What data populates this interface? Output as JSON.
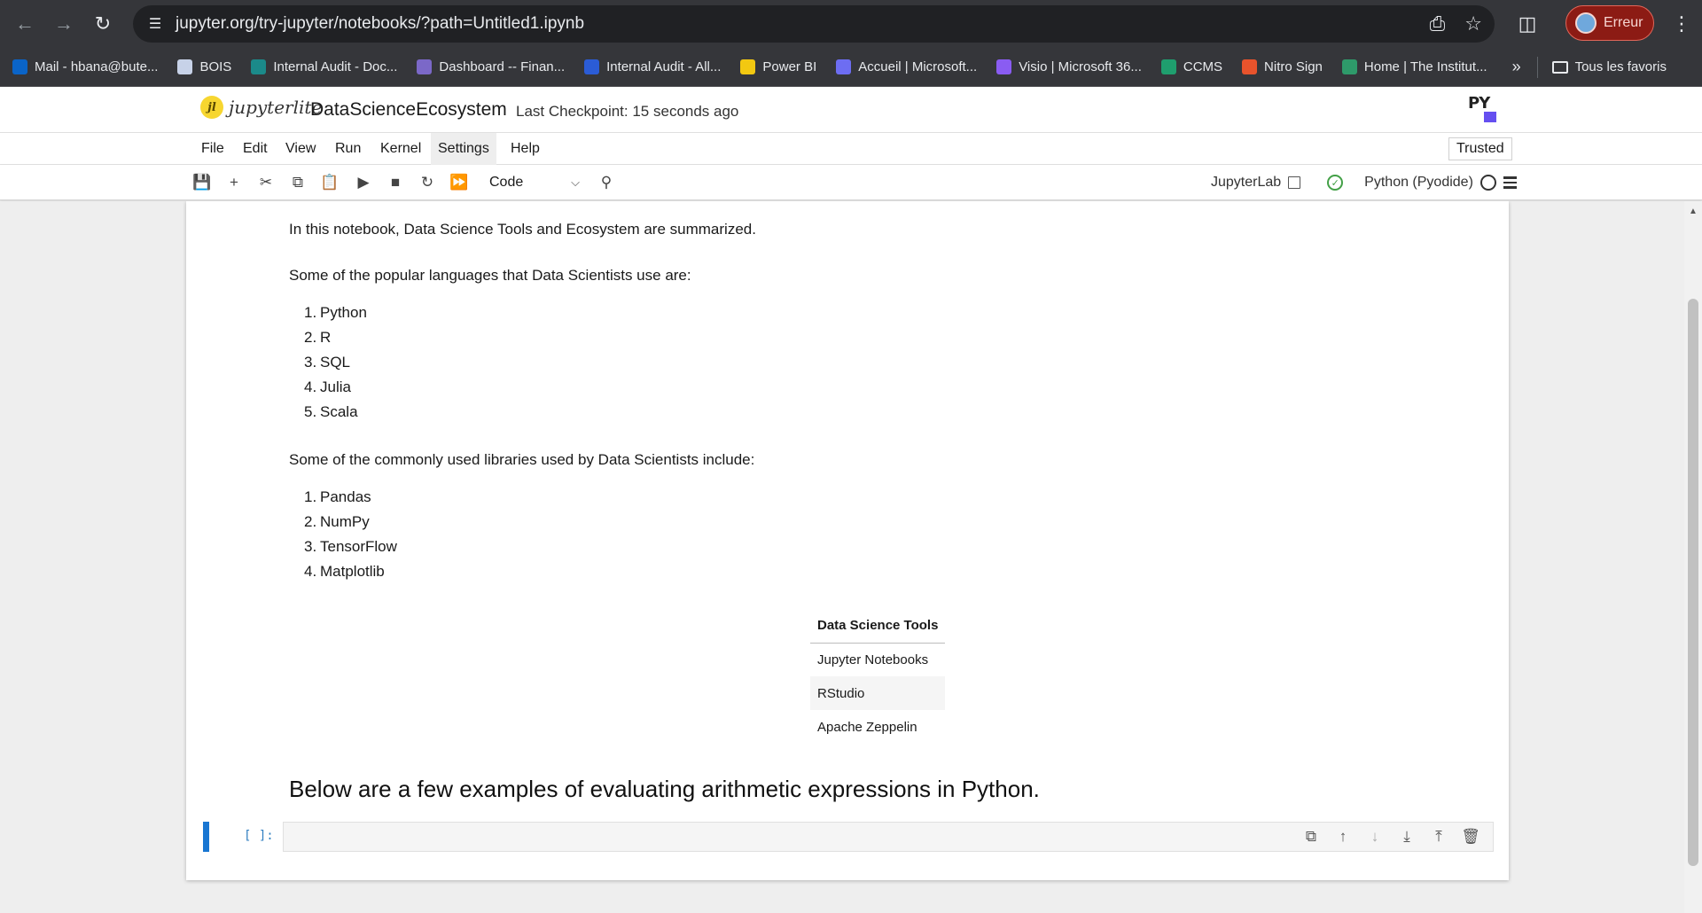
{
  "browser": {
    "url": "jupyter.org/try-jupyter/notebooks/?path=Untitled1.ipynb",
    "profile_label": "Erreur",
    "bookmarks": [
      {
        "label": "Mail - hbana@bute...",
        "color": "#0a64c8"
      },
      {
        "label": "BOIS",
        "color": "#c7d2e8"
      },
      {
        "label": "Internal Audit - Doc...",
        "color": "#1b8a8a"
      },
      {
        "label": "Dashboard -- Finan...",
        "color": "#7b68c8"
      },
      {
        "label": "Internal Audit - All...",
        "color": "#2b5cd6"
      },
      {
        "label": "Power BI",
        "color": "#f2c811"
      },
      {
        "label": "Accueil | Microsoft...",
        "color": "#6d6df2"
      },
      {
        "label": "Visio | Microsoft 36...",
        "color": "#8a5cf2"
      },
      {
        "label": "CCMS",
        "color": "#1f9e6e"
      },
      {
        "label": "Nitro Sign",
        "color": "#e8532c"
      },
      {
        "label": "Home | The Institut...",
        "color": "#2e9a6a"
      }
    ],
    "more_label": "»",
    "all_bookmarks_label": "Tous les favoris"
  },
  "jupyter": {
    "logo_text": "jupyterlite",
    "notebook_title": "DataScienceEcosystem",
    "checkpoint": "Last Checkpoint: 15 seconds ago",
    "py_logo": "PY",
    "menu": [
      "File",
      "Edit",
      "View",
      "Run",
      "Kernel",
      "Settings",
      "Help"
    ],
    "trusted": "Trusted",
    "cell_type": "Code",
    "jupyterlab_link": "JupyterLab",
    "kernel_name": "Python (Pyodide)"
  },
  "notebook": {
    "intro": "In this notebook, Data Science Tools and Ecosystem are summarized.",
    "languages_heading": "Some of the popular languages that Data Scientists use are:",
    "languages": [
      "Python",
      "R",
      "SQL",
      "Julia",
      "Scala"
    ],
    "libraries_heading": "Some of the commonly used libraries used by Data Scientists include:",
    "libraries": [
      "Pandas",
      "NumPy",
      "TensorFlow",
      "Matplotlib"
    ],
    "table_header": "Data Science Tools",
    "tools": [
      "Jupyter Notebooks",
      "RStudio",
      "Apache Zeppelin"
    ],
    "arith_heading": "Below are a few examples of evaluating arithmetic expressions in Python.",
    "cell_prompt": "[ ]:"
  }
}
